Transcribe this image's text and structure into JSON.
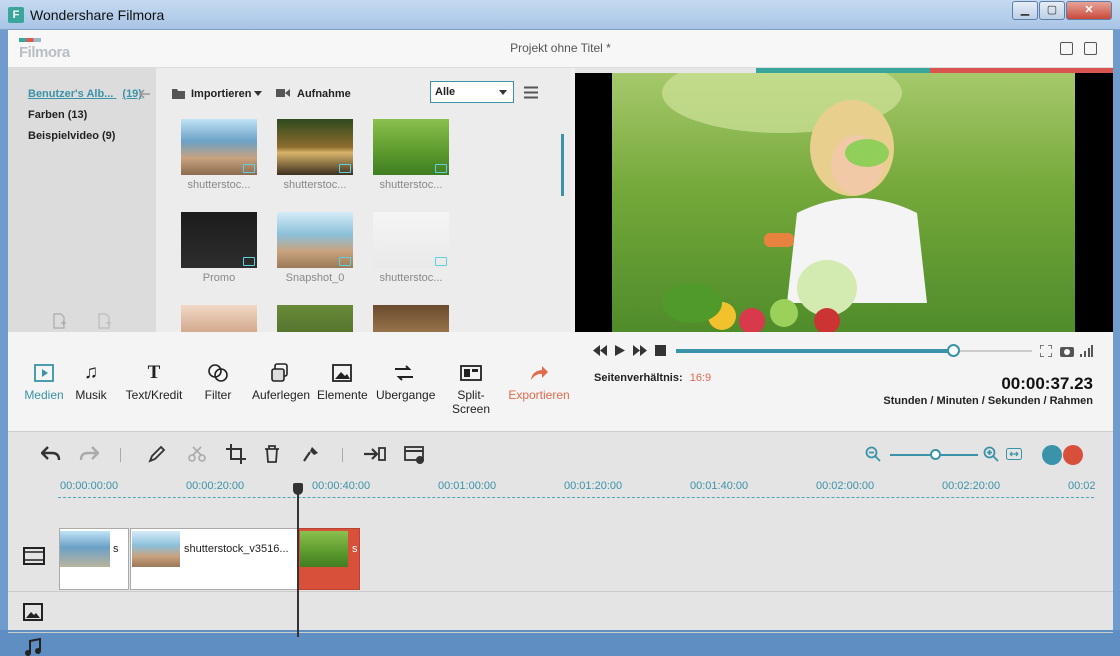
{
  "window": {
    "title": "Wondershare Filmora",
    "minimize": "▁",
    "maximize": "▢",
    "close": "✕"
  },
  "app": {
    "logo": "Filmora",
    "project_title": "Projekt ohne Titel *"
  },
  "albums": [
    {
      "label": "Benutzer's Alb...",
      "count": "(19)"
    },
    {
      "label": "Farben (13)"
    },
    {
      "label": "Beispielvideo (9)"
    }
  ],
  "media_toolbar": {
    "import": "Importieren",
    "record": "Aufnahme",
    "filter_value": "Alle"
  },
  "media_items": [
    {
      "caption": "shutterstoc..."
    },
    {
      "caption": "shutterstoc..."
    },
    {
      "caption": "shutterstoc..."
    },
    {
      "caption": "Promo"
    },
    {
      "caption": "Snapshot_0"
    },
    {
      "caption": "shutterstoc..."
    }
  ],
  "tools": [
    {
      "label": "Medien",
      "icon": "media-icon"
    },
    {
      "label": "Musik",
      "icon": "music-icon"
    },
    {
      "label": "Text/Kredit",
      "icon": "text-icon"
    },
    {
      "label": "Filter",
      "icon": "filter-icon"
    },
    {
      "label": "Auferlegen",
      "icon": "overlay-icon"
    },
    {
      "label": "Elemente",
      "icon": "elements-icon"
    },
    {
      "label": "Ubergange",
      "icon": "transitions-icon"
    },
    {
      "label": "Split-Screen",
      "icon": "split-screen-icon"
    },
    {
      "label": "Exportieren",
      "icon": "export-icon"
    }
  ],
  "player": {
    "aspect_label": "Seitenverhältnis:",
    "aspect_value": "16:9",
    "timecode": "00:00:37.23",
    "time_units": "Stunden / Minuten / Sekunden / Rahmen",
    "progress": 0.78
  },
  "timeline": {
    "ticks": [
      "00:00:00:00",
      "00:00:20:00",
      "00:00:40:00",
      "00:01:00:00",
      "00:01:20:00",
      "00:01:40:00",
      "00:02:00:00",
      "00:02:20:00",
      "00:02"
    ],
    "clips": [
      {
        "label": "s"
      },
      {
        "label": "shutterstock_v3516..."
      },
      {
        "label": "s"
      }
    ]
  },
  "colors": {
    "accent": "#3a93a8",
    "export": "#e06a4d",
    "selected_clip": "#d9503a"
  }
}
